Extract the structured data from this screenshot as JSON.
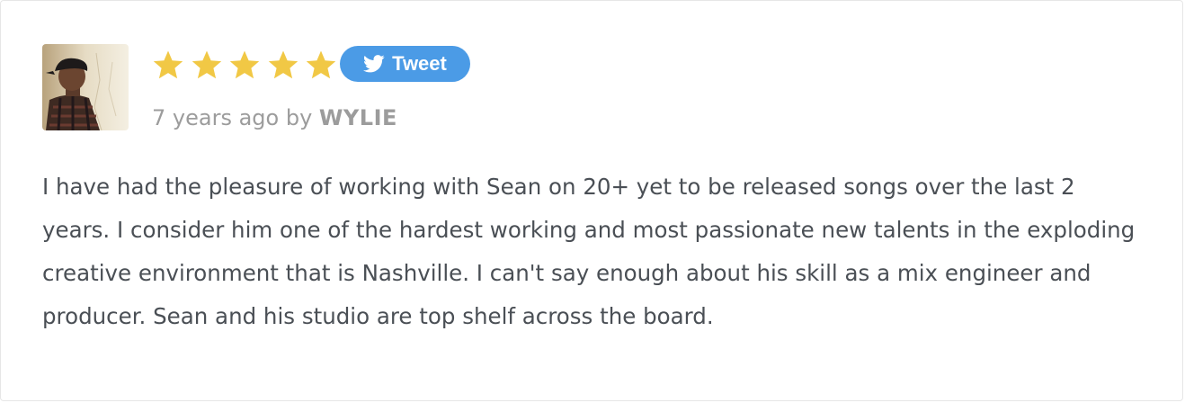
{
  "review": {
    "rating": 5,
    "rating_max": 5,
    "star_color": "#f1c845",
    "tweet_button": {
      "label": "Tweet",
      "icon": "twitter-bird-icon",
      "color": "#4b9be6"
    },
    "time_ago": "7 years ago",
    "by_label": "by",
    "author": "WYLIE",
    "avatar_icon": "user-avatar-photo",
    "text": "I have had the pleasure of working with Sean on 20+ yet to be released songs over the last 2 years. I consider him one of the hardest working and most passionate new talents in the exploding creative environment that is Nashville. I can't say enough about his skill as a mix engineer and producer. Sean and his studio are top shelf across the board."
  }
}
